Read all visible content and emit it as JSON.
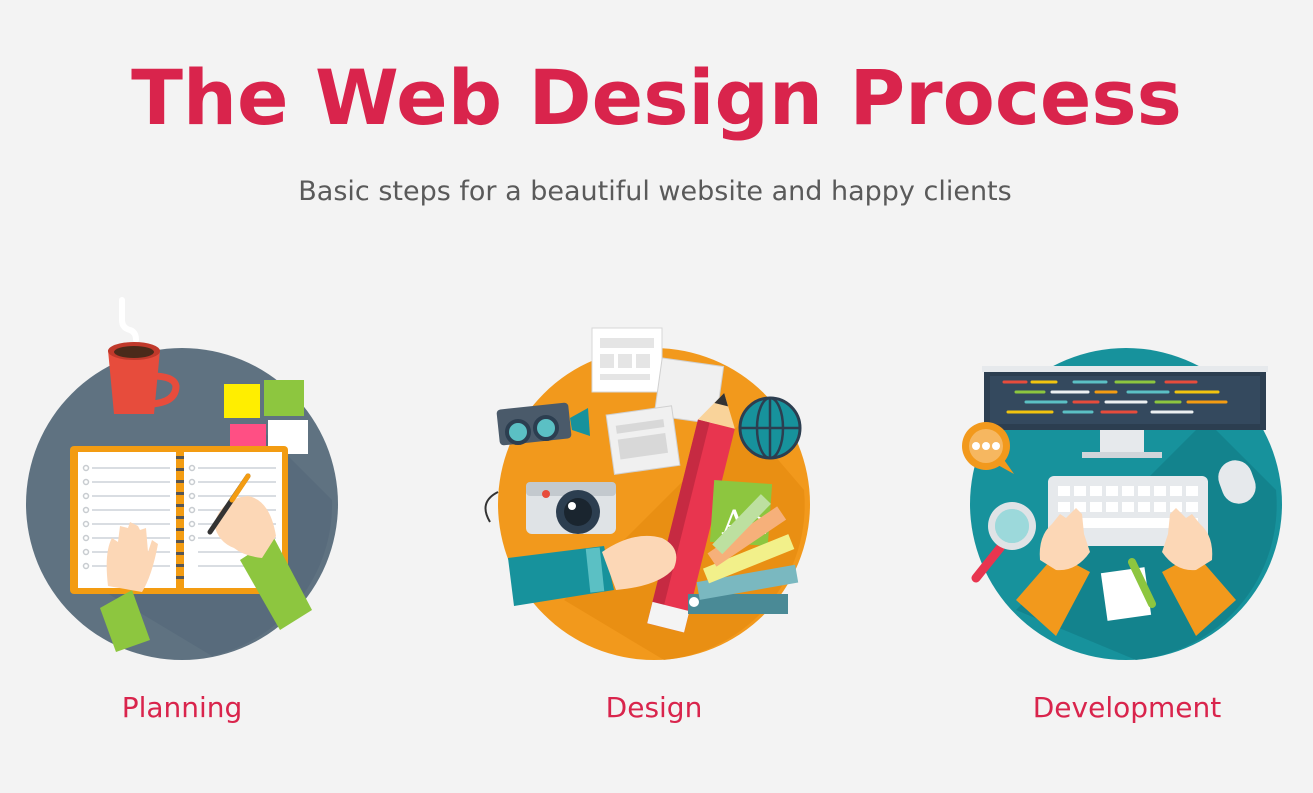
{
  "header": {
    "title": "The Web Design Process",
    "subtitle": "Basic steps for a beautiful website and happy clients"
  },
  "steps": [
    {
      "label": "Planning",
      "icon": "planning-illustration",
      "color": "#5f7281"
    },
    {
      "label": "Design",
      "icon": "design-illustration",
      "color": "#f2991c"
    },
    {
      "label": "Development",
      "icon": "development-illustration",
      "color": "#17929c"
    }
  ],
  "colors": {
    "accent": "#d9244c",
    "subtitle": "#5a5a5a",
    "background": "#f3f3f3"
  }
}
